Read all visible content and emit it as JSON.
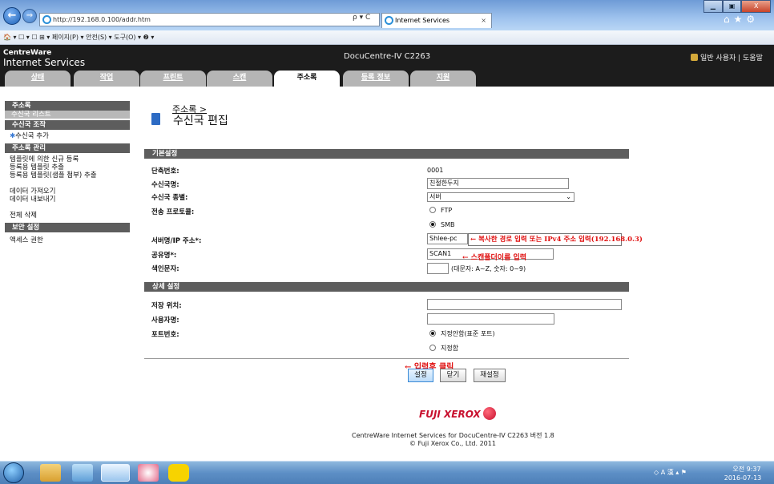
{
  "browser": {
    "address": "http://192.168.0.100/addr.htm",
    "address_controls": "ρ ▾ C",
    "tab_title": "Internet Services",
    "tab_close": "×",
    "window_buttons": [
      "▁",
      "▣",
      "X"
    ],
    "right_icons": "⌂★⚙",
    "command_bar": "🏠 ▾  ☐ ▾ ☐ ⊞ ▾ 페이지(P) ▾  안전(S) ▾  도구(O) ▾  ❷ ▾"
  },
  "app": {
    "logo_line1": "CentreWare",
    "logo_line2": "Internet Services",
    "device_name": "DocuCentre-IV C2263",
    "user_info": "일반 사용자 | 도움말"
  },
  "tabs": [
    {
      "label": "상태"
    },
    {
      "label": "작업"
    },
    {
      "label": "프린트"
    },
    {
      "label": "스캔"
    },
    {
      "label": "주소록"
    },
    {
      "label": "등록 정보"
    },
    {
      "label": "지원"
    }
  ],
  "sidebar": {
    "section_addressbook": "주소록",
    "recipient_list": "수신국 리스트",
    "section_ops": "수신국 조작",
    "add_recipient": "수신국 추가",
    "section_manage": "주소록 관리",
    "manage_item1": "템플릿에 의한 신규 등록",
    "manage_item2": "등록용 템플릿 추출",
    "manage_item3": "등록용 템플릿(샘플 첨부) 추출",
    "import_data": "데이터 가져오기",
    "export_data": "데이터 내보내기",
    "delete_all": "전체 삭제",
    "section_security": "보안 설정",
    "access_rights": "액세스 권한"
  },
  "main": {
    "breadcrumb": "주소록 >",
    "title": "수신국 편집",
    "basic_section": "기본설정",
    "label_speed_dial": "단축번호:",
    "speed_dial": "0001",
    "label_name": "수신국명:",
    "name_value": "친절한두지",
    "label_type": "수신국 종별:",
    "type_value": "서버",
    "label_protocol": "전송 프로토콜:",
    "protocol_ftp": "FTP",
    "protocol_smb": "SMB",
    "label_server": "서버명/IP 주소*:",
    "server_value": "Shlee-pc",
    "server_note": "← 복사한 경로 입력 또는 IPv4 주소 입력(192.168.0.3)",
    "label_share": "공유명*:",
    "share_value": "SCAN1",
    "share_note": "← 스캔폴더이름 입력",
    "label_index": "색인문자:",
    "index_hint": "(대문자: A~Z, 숫자: 0~9)",
    "detail_section": "상세 설정",
    "label_save_location": "저장 위치:",
    "label_username": "사용자명:",
    "label_port": "포트번호:",
    "port_default": "지정안함(표준 포트)",
    "port_specify": "지정함",
    "click_note": "← 입력후 클릭",
    "btn_apply": "설정",
    "btn_close": "닫기",
    "btn_reset": "재설정"
  },
  "footer": {
    "logo": "FUJI XEROX",
    "line1": "CentreWare Internet Services for DocuCentre-IV C2263 버전 1.8",
    "line2": "© Fuji Xerox Co., Ltd. 2011"
  },
  "taskbar": {
    "tray": "◇ A 漢 ▴ ⚑",
    "time": "오전 9:37",
    "date": "2016-07-13"
  }
}
